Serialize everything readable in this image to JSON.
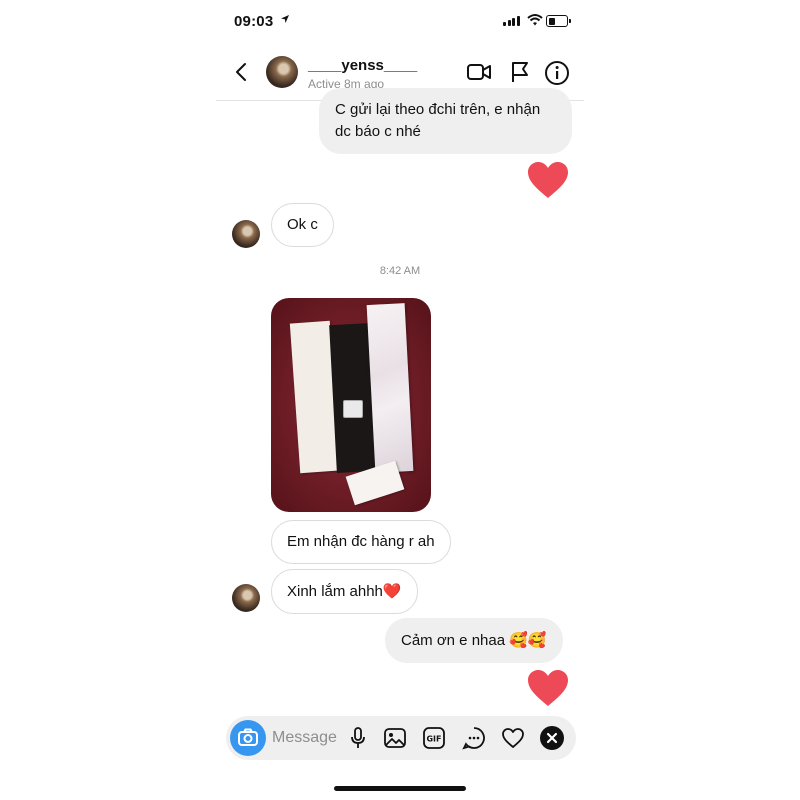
{
  "status_bar": {
    "time": "09:03"
  },
  "header": {
    "username": "____yenss____",
    "active_status": "Active 8m ago"
  },
  "messages": {
    "m1": "C gửi lại theo đchi trên, e nhận dc báo c nhé",
    "m2": "Ok c",
    "timestamp": "8:42 AM",
    "m3": "Em nhận đc hàng r ah",
    "m4_text": "Xinh lắm ahhh",
    "m4_emoji": "❤️",
    "m5_text": "Cảm ơn e nhaa",
    "m5_emoji": "🥰🥰"
  },
  "composer": {
    "placeholder": "Message"
  },
  "colors": {
    "heart": "#ed4956",
    "camera": "#3797f0",
    "bubble_out": "#efefef"
  },
  "icons": [
    "back-icon",
    "video-call-icon",
    "flag-icon",
    "info-icon",
    "camera-icon",
    "microphone-icon",
    "gallery-icon",
    "gif-icon",
    "sticker-icon",
    "like-heart-icon",
    "close-icon"
  ]
}
